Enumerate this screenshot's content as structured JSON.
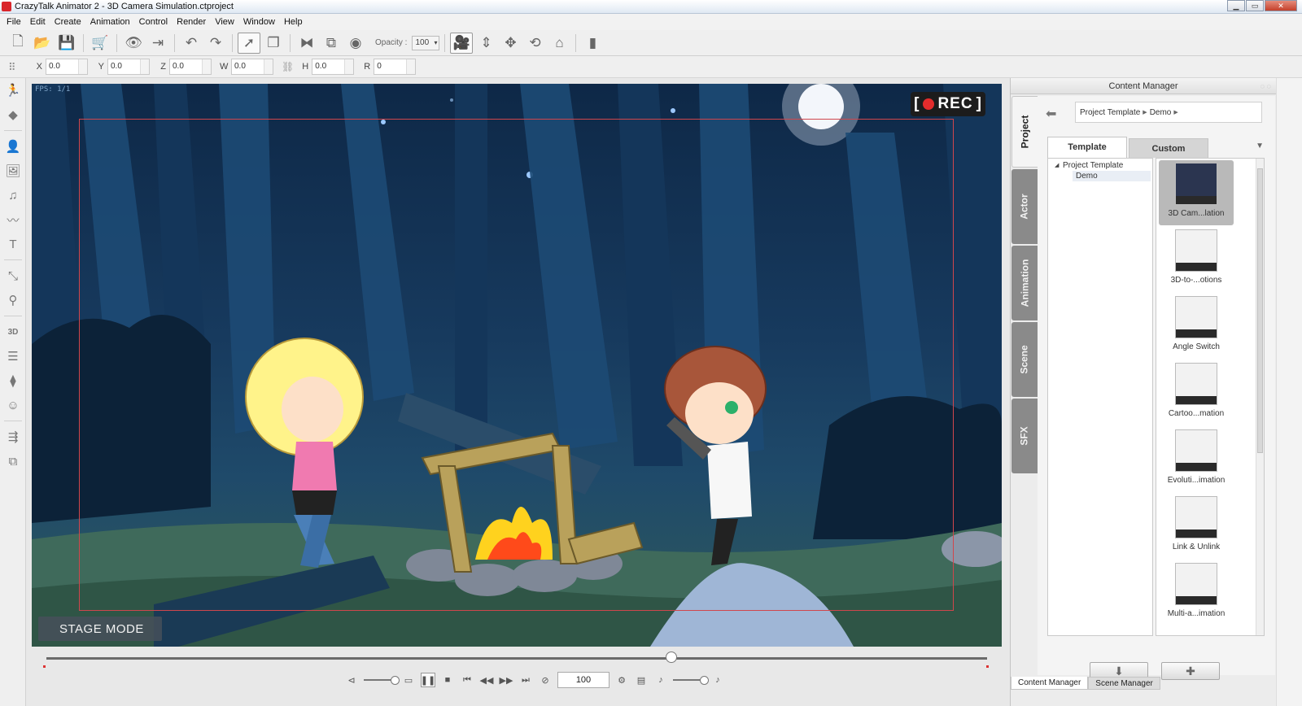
{
  "window": {
    "title": "CrazyTalk Animator 2  - 3D Camera Simulation.ctproject"
  },
  "menu": [
    "File",
    "Edit",
    "Create",
    "Animation",
    "Control",
    "Render",
    "View",
    "Window",
    "Help"
  ],
  "toolbar": {
    "opacity_label": "Opacity :",
    "opacity_value": "100"
  },
  "transform": {
    "x_label": "X",
    "x_value": "0.0",
    "y_label": "Y",
    "y_value": "0.0",
    "z_label": "Z",
    "z_value": "0.0",
    "w_label": "W",
    "w_value": "0.0",
    "h_label": "H",
    "h_value": "0.0",
    "r_label": "R",
    "r_value": "0"
  },
  "stage": {
    "rec_label": "REC",
    "mode_label": "STAGE MODE",
    "frame_info": "FPS: 1/1"
  },
  "timeline": {
    "current_frame": "100",
    "position": 0.664
  },
  "content_manager": {
    "title": "Content Manager",
    "side_tabs": [
      "Project",
      "Actor",
      "Animation",
      "Scene",
      "SFX"
    ],
    "breadcrumb": [
      "Project Template",
      "Demo"
    ],
    "tabs": [
      "Template",
      "Custom"
    ],
    "tree": {
      "root": "Project Template",
      "child": "Demo"
    },
    "thumbnails": [
      "3D Cam...lation",
      "3D-to-...otions",
      "Angle Switch",
      "Cartoo...mation",
      "Evoluti...imation",
      "Link & Unlink",
      "Multi-a...imation"
    ],
    "bottom_tabs": [
      "Content Manager",
      "Scene Manager"
    ]
  },
  "colors": {
    "rec_dot": "#e42c2c",
    "safe_frame": "#d0464c",
    "stage_sky": "#0e2847"
  }
}
